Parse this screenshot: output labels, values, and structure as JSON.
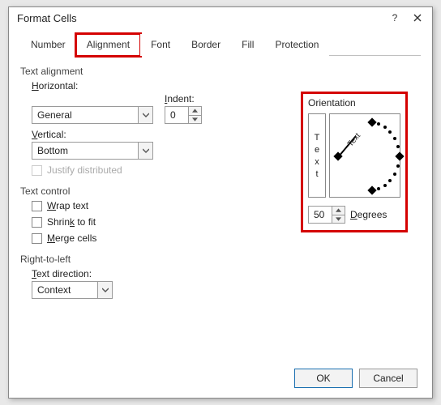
{
  "window": {
    "title": "Format Cells",
    "help_icon_char": "?",
    "close_icon_char": "×"
  },
  "tabs": {
    "number": "Number",
    "alignment": "Alignment",
    "font": "Font",
    "border": "Border",
    "fill": "Fill",
    "protection": "Protection",
    "active": "alignment"
  },
  "text_alignment": {
    "section": "Text alignment",
    "horizontal_label": "Horizontal:",
    "horizontal_value": "General",
    "vertical_label": "Vertical:",
    "vertical_value": "Bottom",
    "indent_label": "Indent:",
    "indent_value": "0",
    "justify_distributed": "Justify distributed"
  },
  "text_control": {
    "section": "Text control",
    "wrap": "Wrap text",
    "shrink": "Shrink to fit",
    "merge": "Merge cells"
  },
  "rtl": {
    "section": "Right-to-left",
    "dir_label": "Text direction:",
    "dir_value": "Context"
  },
  "orientation": {
    "section": "Orientation",
    "vertical_text": "Text",
    "dial_text": "Text",
    "degrees_value": "50",
    "degrees_label": "Degrees"
  },
  "footer": {
    "ok": "OK",
    "cancel": "Cancel"
  }
}
